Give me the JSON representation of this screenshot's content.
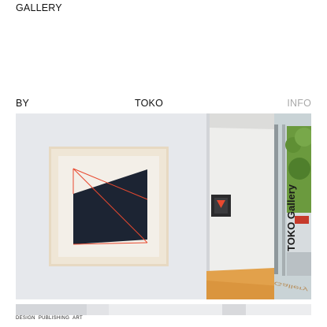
{
  "header": {
    "gallery_label": "GALLERY",
    "by_label": "BY",
    "brand_label": "TOKO",
    "info_label": "INFO"
  },
  "hero": {
    "window_lettering": "TOKO Gallery",
    "floor_lettering": "Gallery"
  },
  "footer": {
    "tags": [
      "DESIGN",
      "PUBLISHING",
      "ART"
    ]
  },
  "colors": {
    "accent_red": "#e8492f",
    "navy": "#1c2433",
    "info_gray": "#a9a9a9"
  }
}
